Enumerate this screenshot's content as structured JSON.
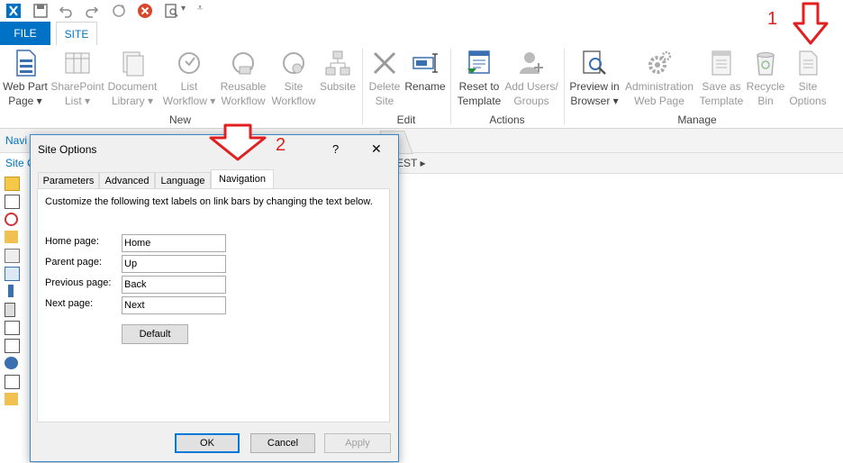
{
  "qat": {
    "icons": [
      "sharepoint-logo-icon",
      "save-icon",
      "undo-icon",
      "redo-icon",
      "refresh-icon",
      "stop-icon",
      "preview-icon",
      "customize-icon"
    ]
  },
  "tabs": {
    "file": "FILE",
    "site": "SITE"
  },
  "ribbon": {
    "buttons": {
      "web_part_page": [
        "Web Part",
        "Page ▾"
      ],
      "sharepoint_list": [
        "SharePoint",
        "List ▾"
      ],
      "document_library": [
        "Document",
        "Library ▾"
      ],
      "list_workflow": [
        "List",
        "Workflow ▾"
      ],
      "reusable_workflow": [
        "Reusable",
        "Workflow"
      ],
      "site_workflow": [
        "Site",
        "Workflow"
      ],
      "subsite": [
        "Subsite",
        ""
      ],
      "delete_site": [
        "Delete",
        "Site"
      ],
      "rename": [
        "Rename",
        ""
      ],
      "reset_template": [
        "Reset to",
        "Template"
      ],
      "add_users": [
        "Add Users/",
        "Groups"
      ],
      "preview_browser": [
        "Preview in",
        "Browser ▾"
      ],
      "admin_web_page": [
        "Administration",
        "Web Page"
      ],
      "save_template": [
        "Save as",
        "Template"
      ],
      "recycle_bin": [
        "Recycle",
        "Bin"
      ],
      "site_options": [
        "Site",
        "Options"
      ]
    },
    "groups": {
      "new": "New",
      "edit": "Edit",
      "actions": "Actions",
      "manage": "Manage"
    }
  },
  "nav": {
    "header": "Navi",
    "site_item": "Site C"
  },
  "breadcrumb": {
    "text": "EST ▸"
  },
  "markers": {
    "one": "1",
    "two": "2"
  },
  "dialog": {
    "title": "Site Options",
    "help": "?",
    "close": "✕",
    "tabs": [
      "Parameters",
      "Advanced",
      "Language",
      "Navigation"
    ],
    "active_tab": "Navigation",
    "description": "Customize the following text labels on link bars by changing the text below.",
    "fields": {
      "home": {
        "label": "Home page:",
        "value": "Home"
      },
      "parent": {
        "label": "Parent page:",
        "value": "Up"
      },
      "previous": {
        "label": "Previous page:",
        "value": "Back"
      },
      "next": {
        "label": "Next page:",
        "value": "Next"
      }
    },
    "default_button": "Default",
    "ok": "OK",
    "cancel": "Cancel",
    "apply": "Apply"
  },
  "colors": {
    "accent": "#0072c6",
    "marker": "#e02020"
  }
}
